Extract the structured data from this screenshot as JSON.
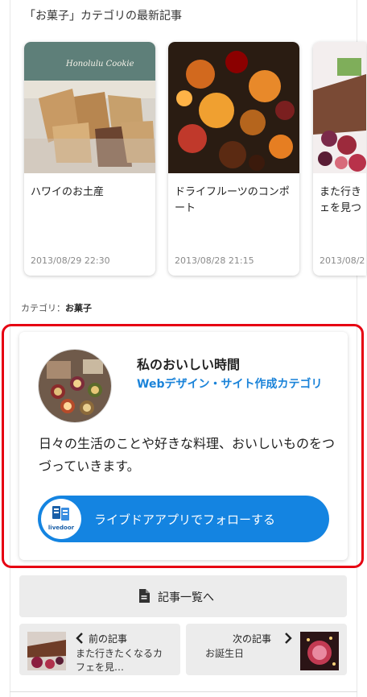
{
  "section": {
    "title": "「お菓子」カテゴリの最新記事"
  },
  "cards": [
    {
      "title": "ハワイのお土産",
      "date": "2013/08/29 22:30",
      "thumb_text": "Honolulu Cookie"
    },
    {
      "title": "ドライフルーツのコンポート",
      "date": "2013/08/28 21:15"
    },
    {
      "title": "また行きたくなるカフェを見つけ",
      "date": "2013/08/2"
    }
  ],
  "category": {
    "prefix": "カテゴリ：",
    "name": "お菓子"
  },
  "profile": {
    "blog_name": "私のおいしい時間",
    "category": "Webデザイン・サイト作成カテゴリ",
    "description": "日々の生活のことや好きな料理、おいしいものをつづっていきます。",
    "follow_label": "ライブドアアプリでフォローする",
    "app_logo_text": "livedoor"
  },
  "nav": {
    "all_posts": "記事一覧へ",
    "prev": {
      "label": "前の記事",
      "title": "また行きたくなるカフェを見…"
    },
    "next": {
      "label": "次の記事",
      "title": "お誕生日"
    }
  },
  "colors": {
    "accent_blue": "#1484e1",
    "highlight_red": "#e60012",
    "link_blue": "#1a83d9"
  },
  "icons": [
    "chevron-left-icon",
    "chevron-right-icon",
    "document-icon",
    "livedoor-app-icon"
  ]
}
